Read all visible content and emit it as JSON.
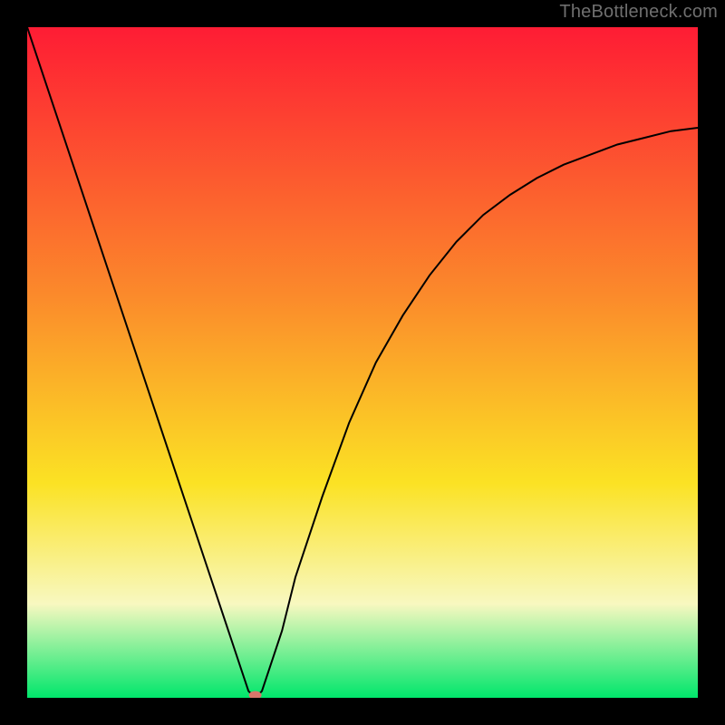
{
  "watermark": {
    "text": "TheBottleneck.com"
  },
  "colors": {
    "frame": "#000000",
    "gradient_top": "#fe1c34",
    "gradient_mid_upper": "#fb8a2b",
    "gradient_mid": "#fbe224",
    "gradient_lower": "#f8f8c0",
    "gradient_bottom": "#00e66b",
    "curve": "#000000",
    "marker": "#d9766b"
  },
  "chart_data": {
    "type": "line",
    "title": "",
    "xlabel": "",
    "ylabel": "",
    "xlim": [
      0,
      100
    ],
    "ylim": [
      0,
      100
    ],
    "x": [
      0,
      2,
      4,
      6,
      8,
      10,
      12,
      14,
      16,
      18,
      20,
      22,
      24,
      26,
      28,
      30,
      32,
      33,
      34,
      35,
      36,
      38,
      40,
      44,
      48,
      52,
      56,
      60,
      64,
      68,
      72,
      76,
      80,
      84,
      88,
      92,
      96,
      100
    ],
    "values": [
      100,
      94,
      88,
      82,
      76,
      70,
      64,
      58,
      52,
      46,
      40,
      34,
      28,
      22,
      16,
      10,
      4,
      1,
      0,
      1,
      4,
      10,
      18,
      30,
      41,
      50,
      57,
      63,
      68,
      72,
      75,
      77.5,
      79.5,
      81,
      82.5,
      83.5,
      84.5,
      85
    ],
    "marker": {
      "x": 34,
      "y": 0
    }
  }
}
